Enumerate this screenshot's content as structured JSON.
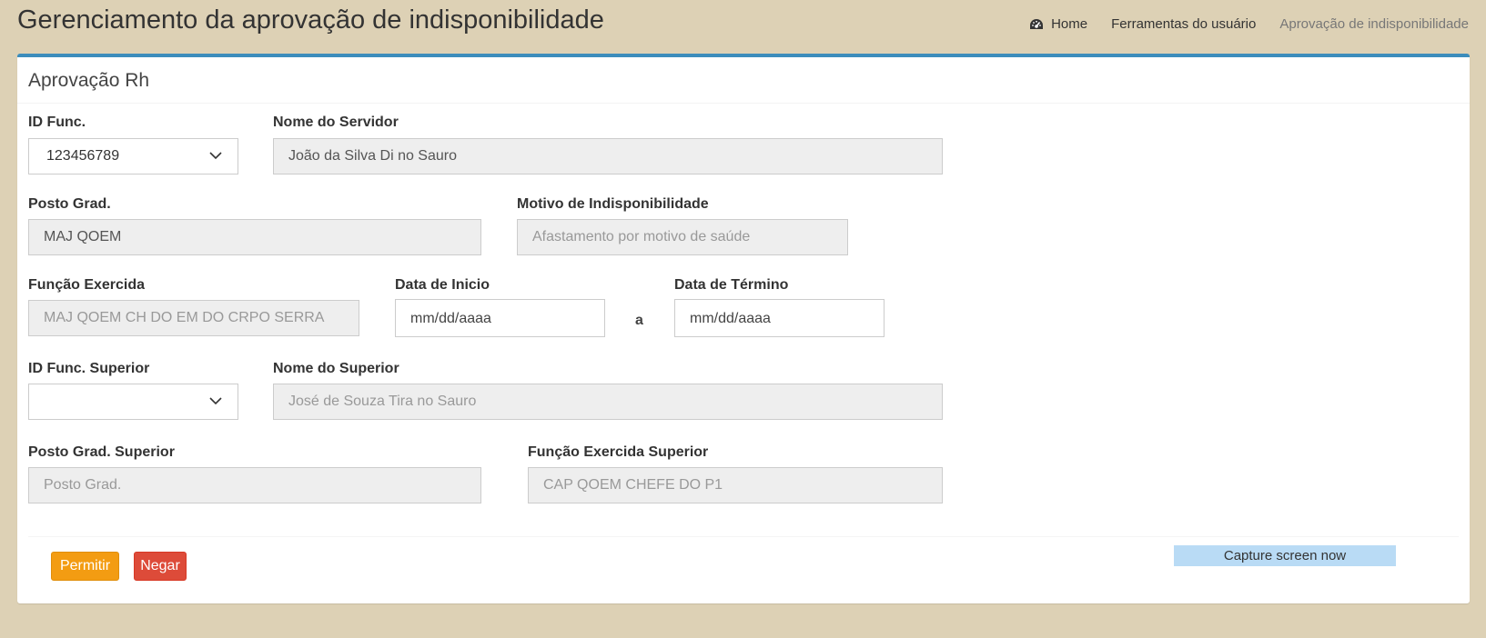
{
  "header": {
    "title": "Gerenciamento da aprovação de indisponibilidade",
    "breadcrumb": [
      {
        "label": "Home",
        "icon": "dashboard-icon"
      },
      {
        "label": "Ferramentas do usuário"
      },
      {
        "label": "Aprovação de indisponibilidade"
      }
    ]
  },
  "box": {
    "title": "Aprovação Rh"
  },
  "form": {
    "id_func": {
      "label": "ID Func.",
      "value": "123456789"
    },
    "nome_servidor": {
      "label": "Nome do Servidor",
      "value": "João da Silva Di no Sauro"
    },
    "posto_grad": {
      "label": "Posto Grad.",
      "value": "MAJ QOEM"
    },
    "motivo": {
      "label": "Motivo de Indisponibilidade",
      "placeholder": "Afastamento por motivo de saúde"
    },
    "funcao": {
      "label": "Função Exercida",
      "placeholder": "MAJ QOEM CH DO EM DO CRPO SERRA"
    },
    "data_inicio": {
      "label": "Data de Inicio",
      "placeholder": "mm/dd/aaaa"
    },
    "date_separator": "a",
    "data_termino": {
      "label": "Data de Término",
      "placeholder": "mm/dd/aaaa"
    },
    "id_func_superior": {
      "label": "ID Func. Superior",
      "value": ""
    },
    "nome_superior": {
      "label": "Nome do Superior",
      "placeholder": "José de Souza Tira no Sauro"
    },
    "posto_grad_superior": {
      "label": "Posto Grad. Superior",
      "placeholder": "Posto Grad."
    },
    "funcao_superior": {
      "label": "Função Exercida Superior",
      "placeholder": "CAP QOEM CHEFE DO P1"
    }
  },
  "actions": {
    "permit_label": "Permitir",
    "deny_label": "Negar",
    "capture_label": "Capture screen now"
  },
  "colors": {
    "background": "#ddd1b5",
    "box_accent": "#3c8dbc",
    "permit": "#f39c12",
    "deny": "#dd4b39",
    "capture": "#b9dbf5"
  }
}
